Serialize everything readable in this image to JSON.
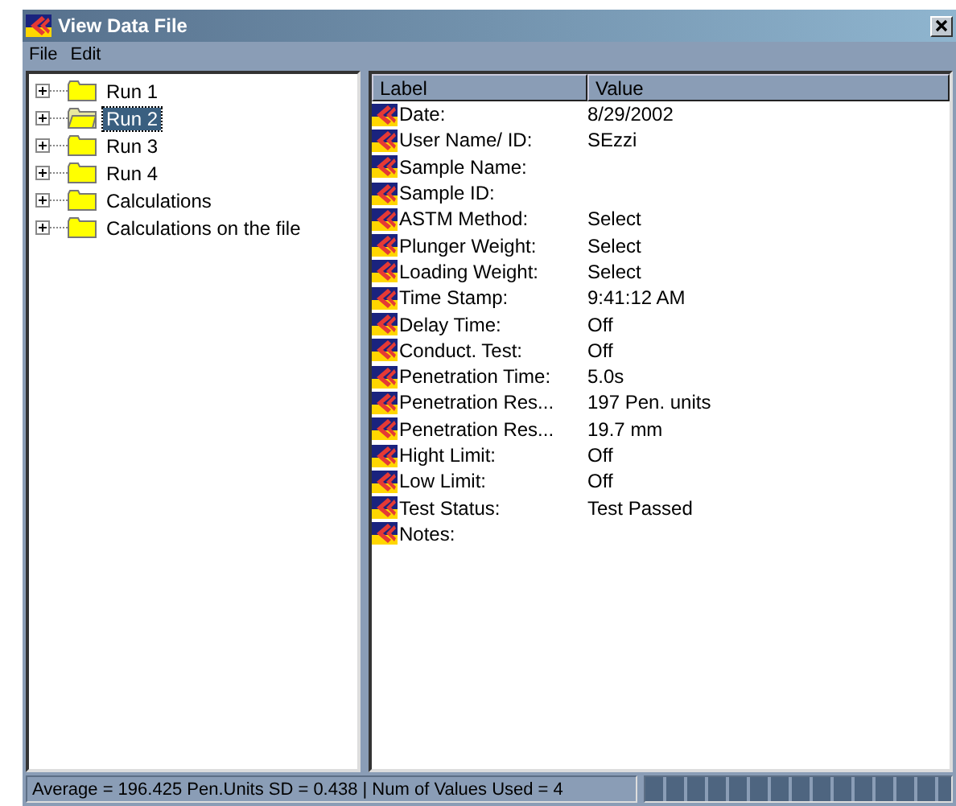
{
  "window": {
    "title": "View Data File"
  },
  "menu": [
    "File",
    "Edit"
  ],
  "tree": [
    {
      "label": "Run 1",
      "selected": false
    },
    {
      "label": "Run 2",
      "selected": true
    },
    {
      "label": "Run 3",
      "selected": false
    },
    {
      "label": "Run 4",
      "selected": false
    },
    {
      "label": "Calculations",
      "selected": false
    },
    {
      "label": "Calculations on the file",
      "selected": false
    }
  ],
  "table": {
    "columns": [
      "Label",
      "Value"
    ],
    "rows": [
      [
        "Date:",
        "8/29/2002"
      ],
      [
        "User Name/ ID:",
        "SEzzi"
      ],
      [
        "Sample Name:",
        ""
      ],
      [
        "Sample ID:",
        ""
      ],
      [
        "ASTM Method:",
        "Select"
      ],
      [
        "Plunger Weight:",
        "Select"
      ],
      [
        "Loading Weight:",
        "Select"
      ],
      [
        "Time Stamp:",
        "9:41:12 AM"
      ],
      [
        "Delay Time:",
        "Off"
      ],
      [
        "Conduct. Test:",
        "Off"
      ],
      [
        "Penetration Time:",
        "5.0s"
      ],
      [
        "Penetration Res...",
        "197 Pen. units"
      ],
      [
        "Penetration Res...",
        "19.7 mm"
      ],
      [
        "Hight Limit:",
        "Off"
      ],
      [
        "Low Limit:",
        "Off"
      ],
      [
        "Test Status:",
        "Test Passed"
      ],
      [
        "Notes:",
        ""
      ]
    ]
  },
  "status_bar": {
    "text": "Average = 196.425 Pen.Units SD = 0.438  |  Num of Values Used = 4",
    "progress": {
      "level": 1
    }
  }
}
